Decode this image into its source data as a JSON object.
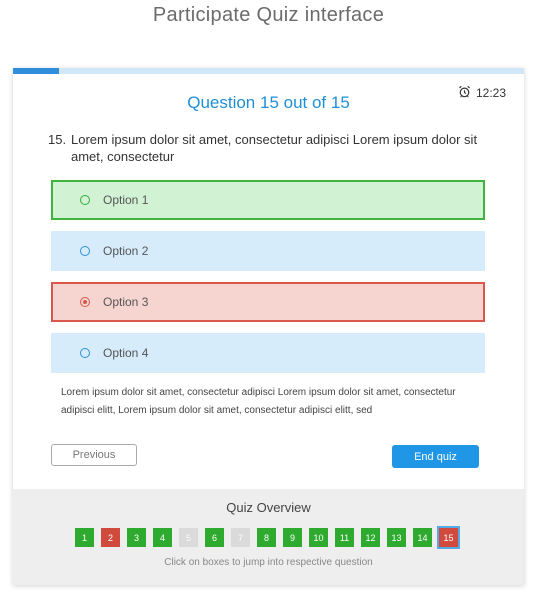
{
  "page_title": "Participate Quiz interface",
  "timer": {
    "time": "12:23",
    "icon": "alarm-clock-icon"
  },
  "progress": {
    "fraction": 0.09
  },
  "question": {
    "counter": "Question 15 out of 15",
    "number": "15.",
    "text": "Lorem ipsum dolor sit amet, consectetur adipisci Lorem ipsum dolor sit amet, consectetur"
  },
  "options": [
    {
      "label": "Option 1",
      "state": "correct"
    },
    {
      "label": "Option 2",
      "state": "neutral"
    },
    {
      "label": "Option 3",
      "state": "wrong-selected"
    },
    {
      "label": "Option 4",
      "state": "neutral"
    }
  ],
  "description": "Lorem ipsum dolor sit amet, consectetur adipisci Lorem ipsum dolor sit amet, consectetur adipisci elitt, Lorem ipsum dolor sit amet, consectetur adipisci elitt, sed",
  "buttons": {
    "previous": "Previous",
    "end": "End quiz"
  },
  "overview": {
    "title": "Quiz Overview",
    "hint": "Click on boxes to jump into respective question",
    "boxes": [
      {
        "label": "1",
        "status": "answered"
      },
      {
        "label": "2",
        "status": "wrong"
      },
      {
        "label": "3",
        "status": "answered"
      },
      {
        "label": "4",
        "status": "answered"
      },
      {
        "label": "5",
        "status": "skipped"
      },
      {
        "label": "6",
        "status": "answered"
      },
      {
        "label": "7",
        "status": "skipped"
      },
      {
        "label": "8",
        "status": "answered"
      },
      {
        "label": "9",
        "status": "answered"
      },
      {
        "label": "10",
        "status": "answered"
      },
      {
        "label": "11",
        "status": "answered"
      },
      {
        "label": "12",
        "status": "answered"
      },
      {
        "label": "13",
        "status": "answered"
      },
      {
        "label": "14",
        "status": "answered"
      },
      {
        "label": "15",
        "status": "current"
      }
    ]
  },
  "colors": {
    "accent": "#1f96e6",
    "correct": "#3cb43f",
    "wrong": "#d9584a",
    "neutral": "#d6ecfb"
  }
}
